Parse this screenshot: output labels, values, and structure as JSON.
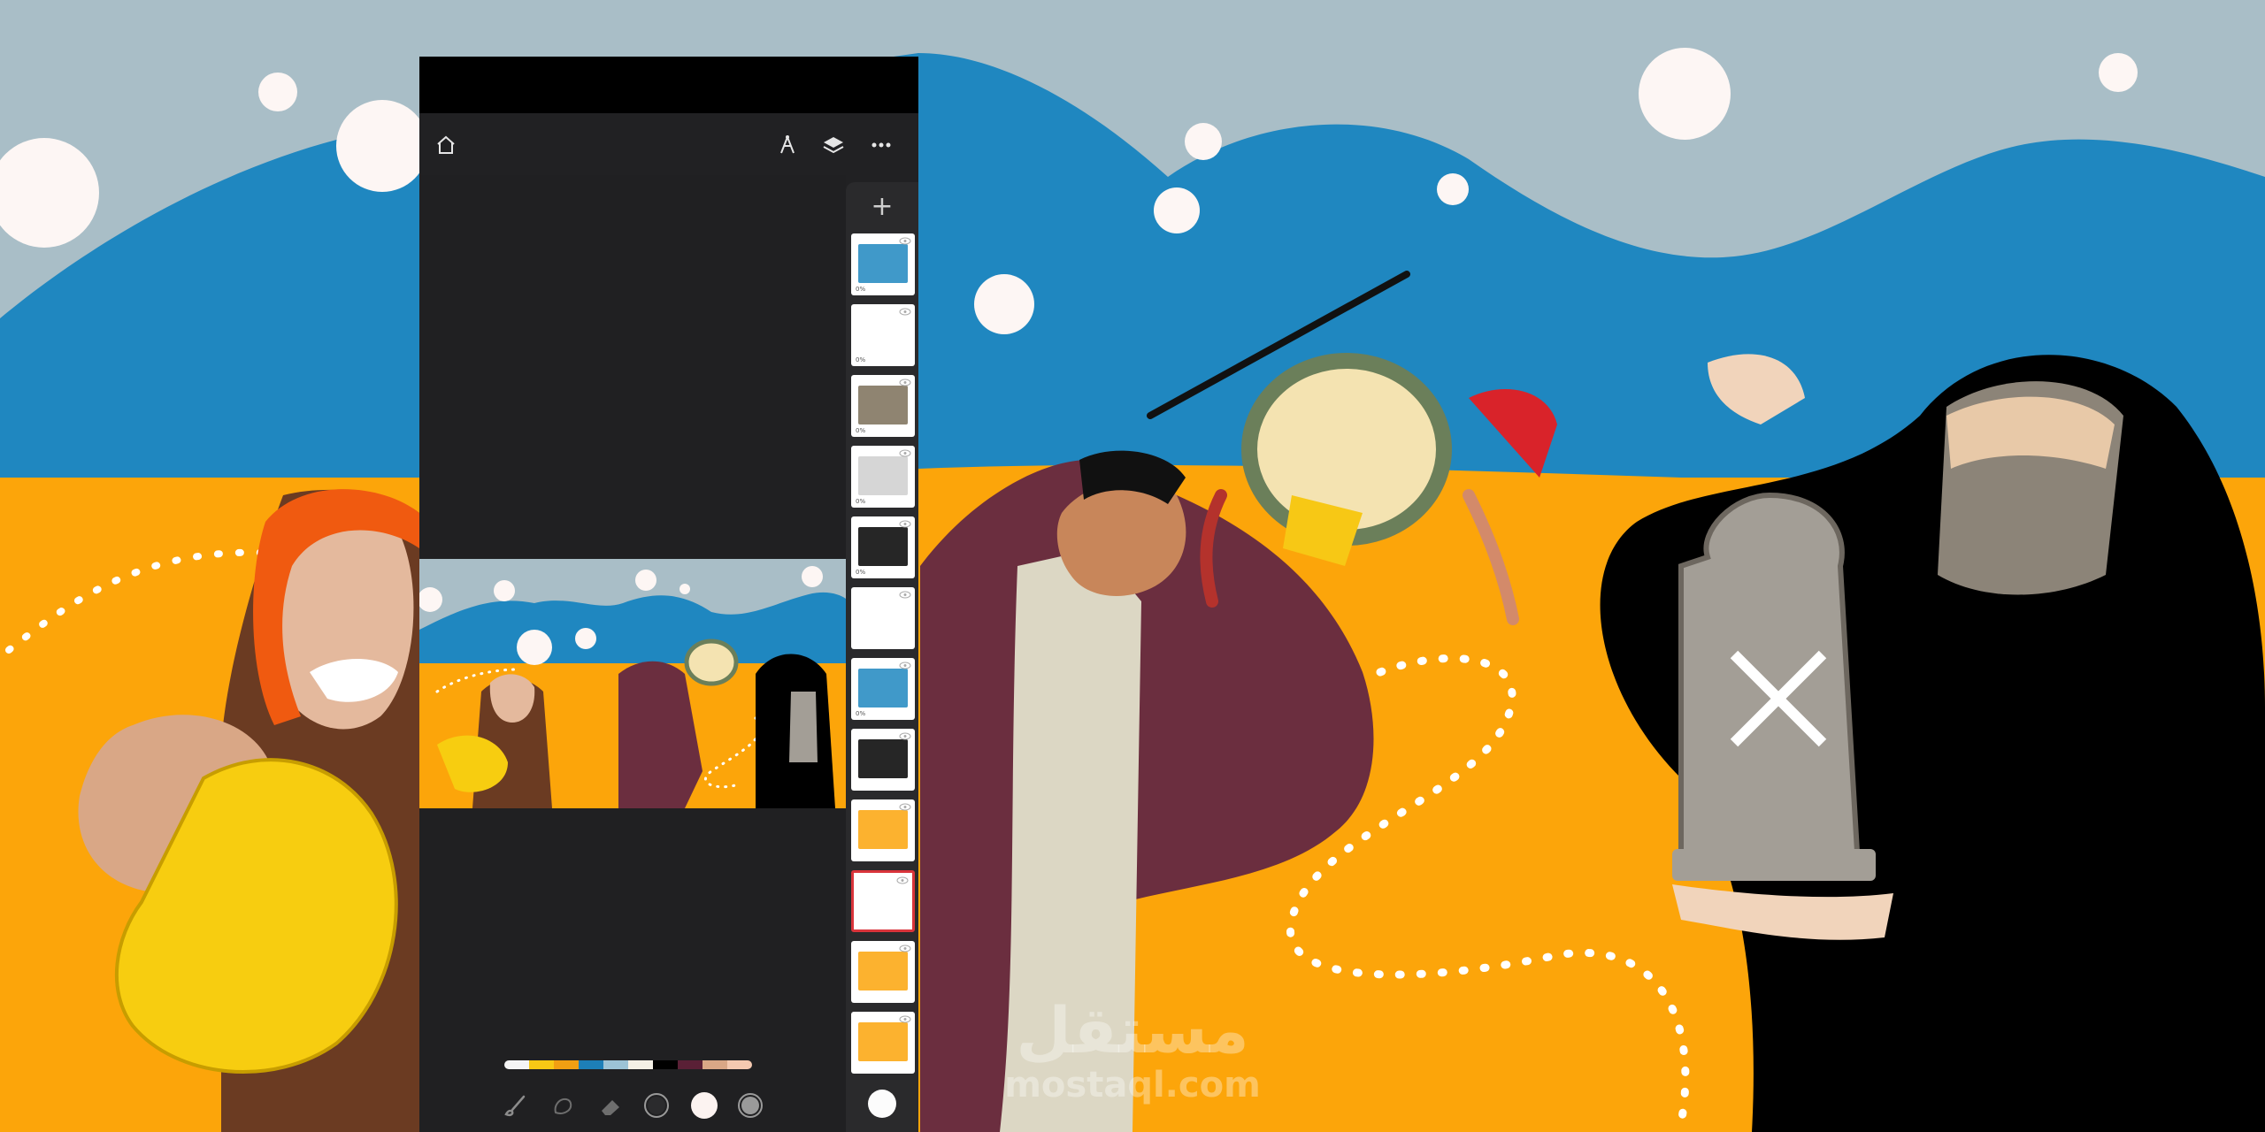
{
  "app": {
    "toolbar_icons": [
      "home-icon",
      "pen-nib-icon",
      "layers-icon",
      "more-icon"
    ],
    "layers_panel": {
      "add_label": "+",
      "layers": [
        {
          "name": "layer-1",
          "opacity_label": "0%",
          "visible": true,
          "selected": false
        },
        {
          "name": "layer-2",
          "opacity_label": "0%",
          "visible": true,
          "selected": false
        },
        {
          "name": "layer-3",
          "opacity_label": "0%",
          "visible": true,
          "selected": false
        },
        {
          "name": "layer-4",
          "opacity_label": "0%",
          "visible": true,
          "selected": false
        },
        {
          "name": "layer-5",
          "opacity_label": "0%",
          "visible": true,
          "selected": false
        },
        {
          "name": "layer-6",
          "opacity_label": "",
          "visible": true,
          "selected": false
        },
        {
          "name": "layer-7",
          "opacity_label": "0%",
          "visible": true,
          "selected": false
        },
        {
          "name": "layer-8",
          "opacity_label": "",
          "visible": true,
          "selected": false
        },
        {
          "name": "layer-9",
          "opacity_label": "",
          "visible": true,
          "selected": false
        },
        {
          "name": "layer-10",
          "opacity_label": "",
          "visible": true,
          "selected": true
        },
        {
          "name": "layer-11",
          "opacity_label": "",
          "visible": true,
          "selected": false
        },
        {
          "name": "layer-12",
          "opacity_label": "",
          "visible": true,
          "selected": false
        }
      ]
    },
    "palette_colors": [
      "#f5f5f5",
      "#f7c815",
      "#f19f12",
      "#1d7fb8",
      "#9cc3d6",
      "#f4f0e6",
      "#000000",
      "#5a2036",
      "#d9a786",
      "#f4c9b0"
    ],
    "bottom_tools": [
      "brush-tool-icon",
      "smudge-tool-icon",
      "eraser-tool-icon",
      "brush-size-icon",
      "color-white-icon",
      "opacity-icon"
    ]
  },
  "watermark": {
    "arabic": "مستقل",
    "latin": "mostaql.com"
  },
  "colors": {
    "sky": "#a9bec7",
    "mountains": "#1f87c0",
    "sand": "#fca50a",
    "app_bg": "#212123",
    "panel": "#2a2a2c",
    "selected_layer": "#d9343b"
  }
}
